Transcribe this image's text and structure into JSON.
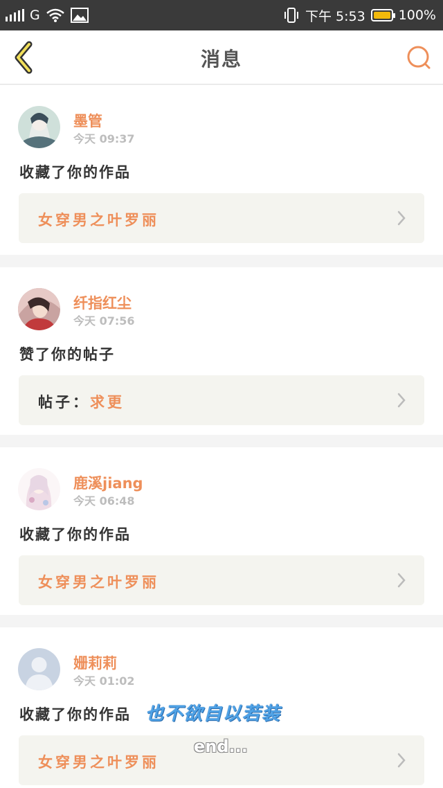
{
  "status_bar": {
    "carrier": "G",
    "time": "下午 5:53",
    "battery": "100%",
    "battery_level": 1.0
  },
  "navbar": {
    "title": "消息",
    "back_icon": "chevron-left-icon",
    "search_icon": "search-icon"
  },
  "messages": [
    {
      "user": "墨管",
      "time": "今天 09:37",
      "action": "收藏了你的作品",
      "target_prefix": "",
      "target": "女穿男之叶罗丽"
    },
    {
      "user": "纤指红尘",
      "time": "今天 07:56",
      "action": "赞了你的帖子",
      "target_prefix": "帖子：",
      "target": "求更"
    },
    {
      "user": "鹿溪jiang",
      "time": "今天 06:48",
      "action": "收藏了你的作品",
      "target_prefix": "",
      "target": "女穿男之叶罗丽"
    },
    {
      "user": "姗莉莉",
      "time": "今天 01:02",
      "action": "收藏了你的作品",
      "target_prefix": "",
      "target": "女穿男之叶罗丽"
    }
  ],
  "overlay": {
    "caption": "也不欲自以若装",
    "end": "end..."
  },
  "colors": {
    "accent": "#ee8f5a",
    "status_bar": "#3a3a3a",
    "battery": "#f2b90b",
    "overlay_blue": "#4fa2e6"
  }
}
